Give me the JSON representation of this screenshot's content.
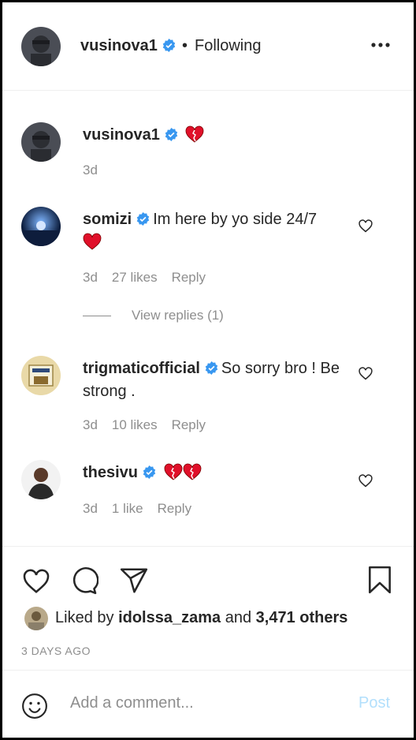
{
  "header": {
    "username": "vusinova1",
    "dot": "•",
    "follow_status": "Following"
  },
  "comments": [
    {
      "username": "vusinova1",
      "text": "",
      "hearts": [
        "broken-heart"
      ],
      "time": "3d",
      "likes": "",
      "reply": ""
    },
    {
      "username": "somizi",
      "text": "Im here by yo side 24/7",
      "hearts": [
        "red-heart"
      ],
      "time": "3d",
      "likes": "27 likes",
      "reply": "Reply"
    },
    {
      "username": "trigmaticofficial",
      "text": "So sorry bro ! Be strong .",
      "time": "3d",
      "likes": "10 likes",
      "reply": "Reply"
    },
    {
      "username": "thesivu",
      "text": "",
      "hearts": [
        "broken-heart",
        "broken-heart"
      ],
      "time": "3d",
      "likes": "1 like",
      "reply": "Reply"
    }
  ],
  "view_replies": "View replies (1)",
  "likes": {
    "prefix": "Liked by",
    "user": "idolssa_zama",
    "joiner": "and",
    "others": "3,471 others"
  },
  "posted": "3 DAYS AGO",
  "comment_box": {
    "placeholder": "Add a comment...",
    "post_label": "Post"
  },
  "colors": {
    "verified": "#3897f0",
    "heart_red": "#e0102a",
    "post_disabled": "#b2dffc",
    "muted": "#8e8e8e"
  },
  "icons": [
    "more-options-icon",
    "verified-badge-icon",
    "like-icon",
    "comment-icon",
    "share-icon",
    "save-icon",
    "emoji-icon"
  ]
}
